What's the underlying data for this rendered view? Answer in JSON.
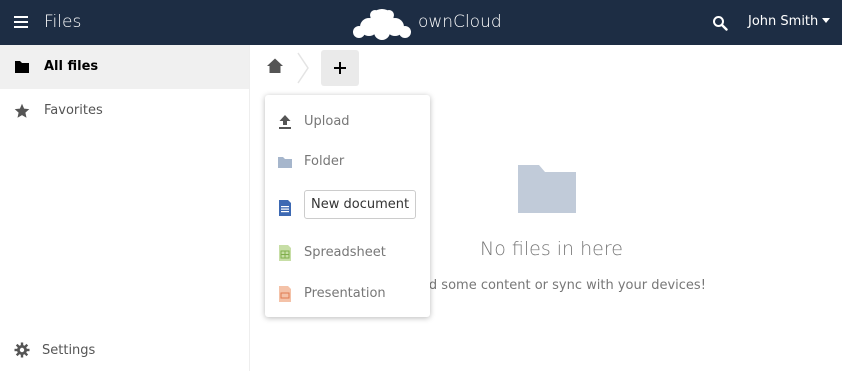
{
  "header": {
    "app_title": "Files",
    "brand": "ownCloud",
    "user_name": "John Smith",
    "icons": {
      "menu": "hamburger-menu-icon",
      "logo": "owncloud-logo",
      "search": "search-icon"
    }
  },
  "sidebar": {
    "items": [
      {
        "label": "All files",
        "icon": "folder-icon",
        "active": true
      },
      {
        "label": "Favorites",
        "icon": "star-icon",
        "active": false
      }
    ],
    "settings_label": "Settings"
  },
  "controls": {
    "home_icon": "home-icon",
    "new_button_icon": "plus-icon"
  },
  "new_menu": {
    "items": [
      {
        "label": "Upload",
        "icon": "upload-icon"
      },
      {
        "label": "Folder",
        "icon": "folder-icon"
      },
      {
        "label": "",
        "icon": "document-icon",
        "input_value": "New document"
      },
      {
        "label": "Spreadsheet",
        "icon": "spreadsheet-icon"
      },
      {
        "label": "Presentation",
        "icon": "presentation-icon"
      }
    ]
  },
  "empty_content": {
    "title": "No files in here",
    "hint": "oad some content or sync with your devices!"
  },
  "colors": {
    "header_bg": "#1d2d44",
    "folder_icon": "#a6b6cc",
    "document_icon": "#3d69b3",
    "spreadsheet_icon": "#9dc36b",
    "presentation_icon": "#e8936c"
  }
}
